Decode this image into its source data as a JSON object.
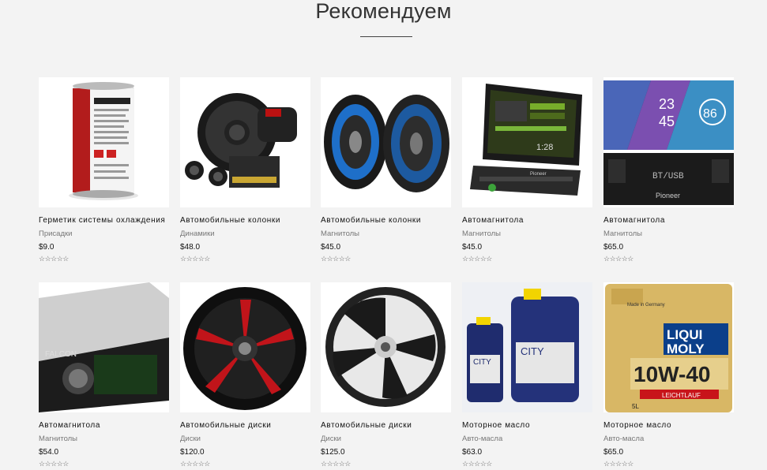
{
  "section": {
    "title": "Рекомендуем"
  },
  "products": [
    {
      "name": "Герметик системы охлаждения",
      "category": "Присадки",
      "price": "$9.0",
      "rating_stars": "☆☆☆☆☆",
      "rating": 0
    },
    {
      "name": "Автомобильные колонки",
      "category": "Динамики",
      "price": "$48.0",
      "rating_stars": "☆☆☆☆☆",
      "rating": 0
    },
    {
      "name": "Автомобильные колонки",
      "category": "Магнитолы",
      "price": "$45.0",
      "rating_stars": "☆☆☆☆☆",
      "rating": 0
    },
    {
      "name": "Автомагнитола",
      "category": "Магнитолы",
      "price": "$45.0",
      "rating_stars": "☆☆☆☆☆",
      "rating": 0
    },
    {
      "name": "Автомагнитола",
      "category": "Магнитолы",
      "price": "$65.0",
      "rating_stars": "☆☆☆☆☆",
      "rating": 0
    },
    {
      "name": "Автомагнитола",
      "category": "Магнитолы",
      "price": "$54.0",
      "rating_stars": "☆☆☆☆☆",
      "rating": 0
    },
    {
      "name": "Автомобильные диски",
      "category": "Диски",
      "price": "$120.0",
      "rating_stars": "☆☆☆☆☆",
      "rating": 0
    },
    {
      "name": "Автомобильные диски",
      "category": "Диски",
      "price": "$125.0",
      "rating_stars": "☆☆☆☆☆",
      "rating": 0
    },
    {
      "name": "Моторное масло",
      "category": "Авто-масла",
      "price": "$63.0",
      "rating_stars": "☆☆☆☆☆",
      "rating": 0
    },
    {
      "name": "Моторное масло",
      "category": "Авто-масла",
      "price": "$65.0",
      "rating_stars": "☆☆☆☆☆",
      "rating": 0
    }
  ],
  "image_text": {
    "display_1_time": "1:28",
    "display_2_time_h": "23",
    "display_2_time_m": "45",
    "display_2_temp": "86",
    "display_2_panel": "BT/USB",
    "brand_pioneer": "Pioneer",
    "radio_label": "FALCON",
    "oil_brand": "CITY",
    "liqui_brand_1": "LIQUI",
    "liqui_brand_2": "MOLY",
    "liqui_grade": "10W-40",
    "liqui_sub": "LEICHTLAUF",
    "liqui_made": "Made in Germany",
    "liqui_volume": "5L"
  }
}
